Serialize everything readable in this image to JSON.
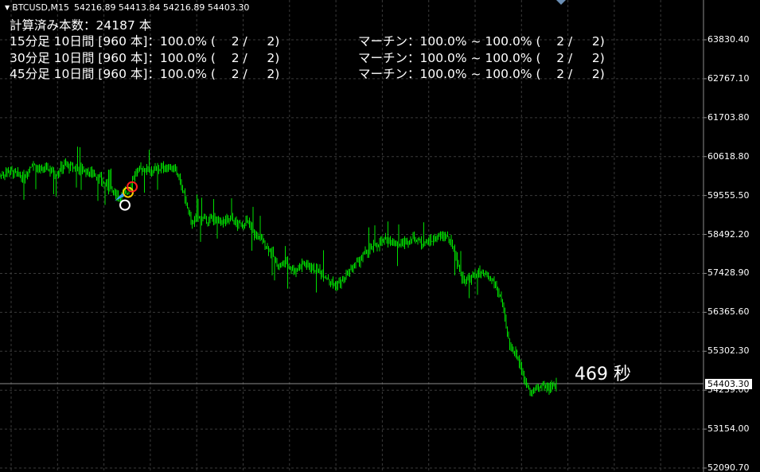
{
  "header": {
    "symbol": "BTCUSD,M15",
    "ohlc": "54216.89 54413.84 54216.89 54403.30"
  },
  "info": {
    "count_line": "計算済み本数：24187 本",
    "rows": [
      {
        "left": "15分足 10日間 [960 本]：100.0% (    2 /     2)",
        "right": "マーチン：100.0% ~ 100.0% (    2 /     2)"
      },
      {
        "left": "30分足 10日間 [960 本]：100.0% (    2 /     2)",
        "right": "マーチン：100.0% ~ 100.0% (    2 /     2)"
      },
      {
        "left": "45分足 10日間 [960 本]：100.0% (    2 /     2)",
        "right": "マーチン：100.0% ~ 100.0% (    2 /     2)"
      }
    ]
  },
  "timer": "469 秒",
  "price_axis": {
    "labels": [
      "63830.40",
      "62767.10",
      "61703.80",
      "60618.80",
      "59555.50",
      "58492.20",
      "57428.90",
      "56365.60",
      "55302.30",
      "54239.00",
      "53154.00",
      "52090.70"
    ],
    "current_price": "54403.30"
  },
  "colors": {
    "background": "#000000",
    "grid": "#3a3a3a",
    "candle": "#00e000",
    "current_line": "#8c8c8c",
    "text": "#ffffff"
  },
  "chart_data": {
    "type": "candlestick",
    "symbol": "BTCUSD",
    "timeframe": "M15",
    "ylim": [
      52090.7,
      63830.4
    ],
    "close_path": [
      [
        0,
        60100
      ],
      [
        10,
        60250
      ],
      [
        20,
        60150
      ],
      [
        30,
        60050
      ],
      [
        40,
        60450
      ],
      [
        50,
        60250
      ],
      [
        60,
        60300
      ],
      [
        70,
        60150
      ],
      [
        80,
        60400
      ],
      [
        90,
        60350
      ],
      [
        100,
        60300
      ],
      [
        110,
        60200
      ],
      [
        120,
        60150
      ],
      [
        130,
        59900
      ],
      [
        140,
        59700
      ],
      [
        150,
        59550
      ],
      [
        160,
        59650
      ],
      [
        170,
        60200
      ],
      [
        180,
        60300
      ],
      [
        190,
        60250
      ],
      [
        200,
        60300
      ],
      [
        210,
        60350
      ],
      [
        220,
        60300
      ],
      [
        230,
        59700
      ],
      [
        240,
        58800
      ],
      [
        250,
        58950
      ],
      [
        260,
        58900
      ],
      [
        270,
        58900
      ],
      [
        280,
        58850
      ],
      [
        290,
        58900
      ],
      [
        300,
        58750
      ],
      [
        310,
        58850
      ],
      [
        320,
        58500
      ],
      [
        330,
        58300
      ],
      [
        340,
        58050
      ],
      [
        350,
        57600
      ],
      [
        360,
        57700
      ],
      [
        370,
        57500
      ],
      [
        380,
        57700
      ],
      [
        390,
        57600
      ],
      [
        400,
        57500
      ],
      [
        410,
        57350
      ],
      [
        420,
        57100
      ],
      [
        430,
        57200
      ],
      [
        440,
        57500
      ],
      [
        450,
        57750
      ],
      [
        460,
        58000
      ],
      [
        470,
        58150
      ],
      [
        480,
        58300
      ],
      [
        490,
        58350
      ],
      [
        500,
        58200
      ],
      [
        510,
        58300
      ],
      [
        520,
        58400
      ],
      [
        530,
        58250
      ],
      [
        540,
        58300
      ],
      [
        550,
        58400
      ],
      [
        560,
        58500
      ],
      [
        570,
        58100
      ],
      [
        580,
        57300
      ],
      [
        590,
        57250
      ],
      [
        600,
        57450
      ],
      [
        610,
        57350
      ],
      [
        620,
        57200
      ],
      [
        630,
        56700
      ],
      [
        640,
        55450
      ],
      [
        650,
        55200
      ],
      [
        660,
        54400
      ],
      [
        670,
        54200
      ],
      [
        680,
        54350
      ],
      [
        690,
        54300
      ],
      [
        700,
        54400
      ]
    ],
    "signals": [
      {
        "type": "circle",
        "color": "#ffffff",
        "x": 157,
        "y": 59300
      },
      {
        "type": "circle",
        "color": "#ffd000",
        "x": 161,
        "y": 59650
      },
      {
        "type": "circle",
        "color": "#ff2020",
        "x": 166,
        "y": 59800
      },
      {
        "type": "arrow",
        "color": "#3aa0ff",
        "x": 150,
        "y": 59500
      }
    ]
  }
}
